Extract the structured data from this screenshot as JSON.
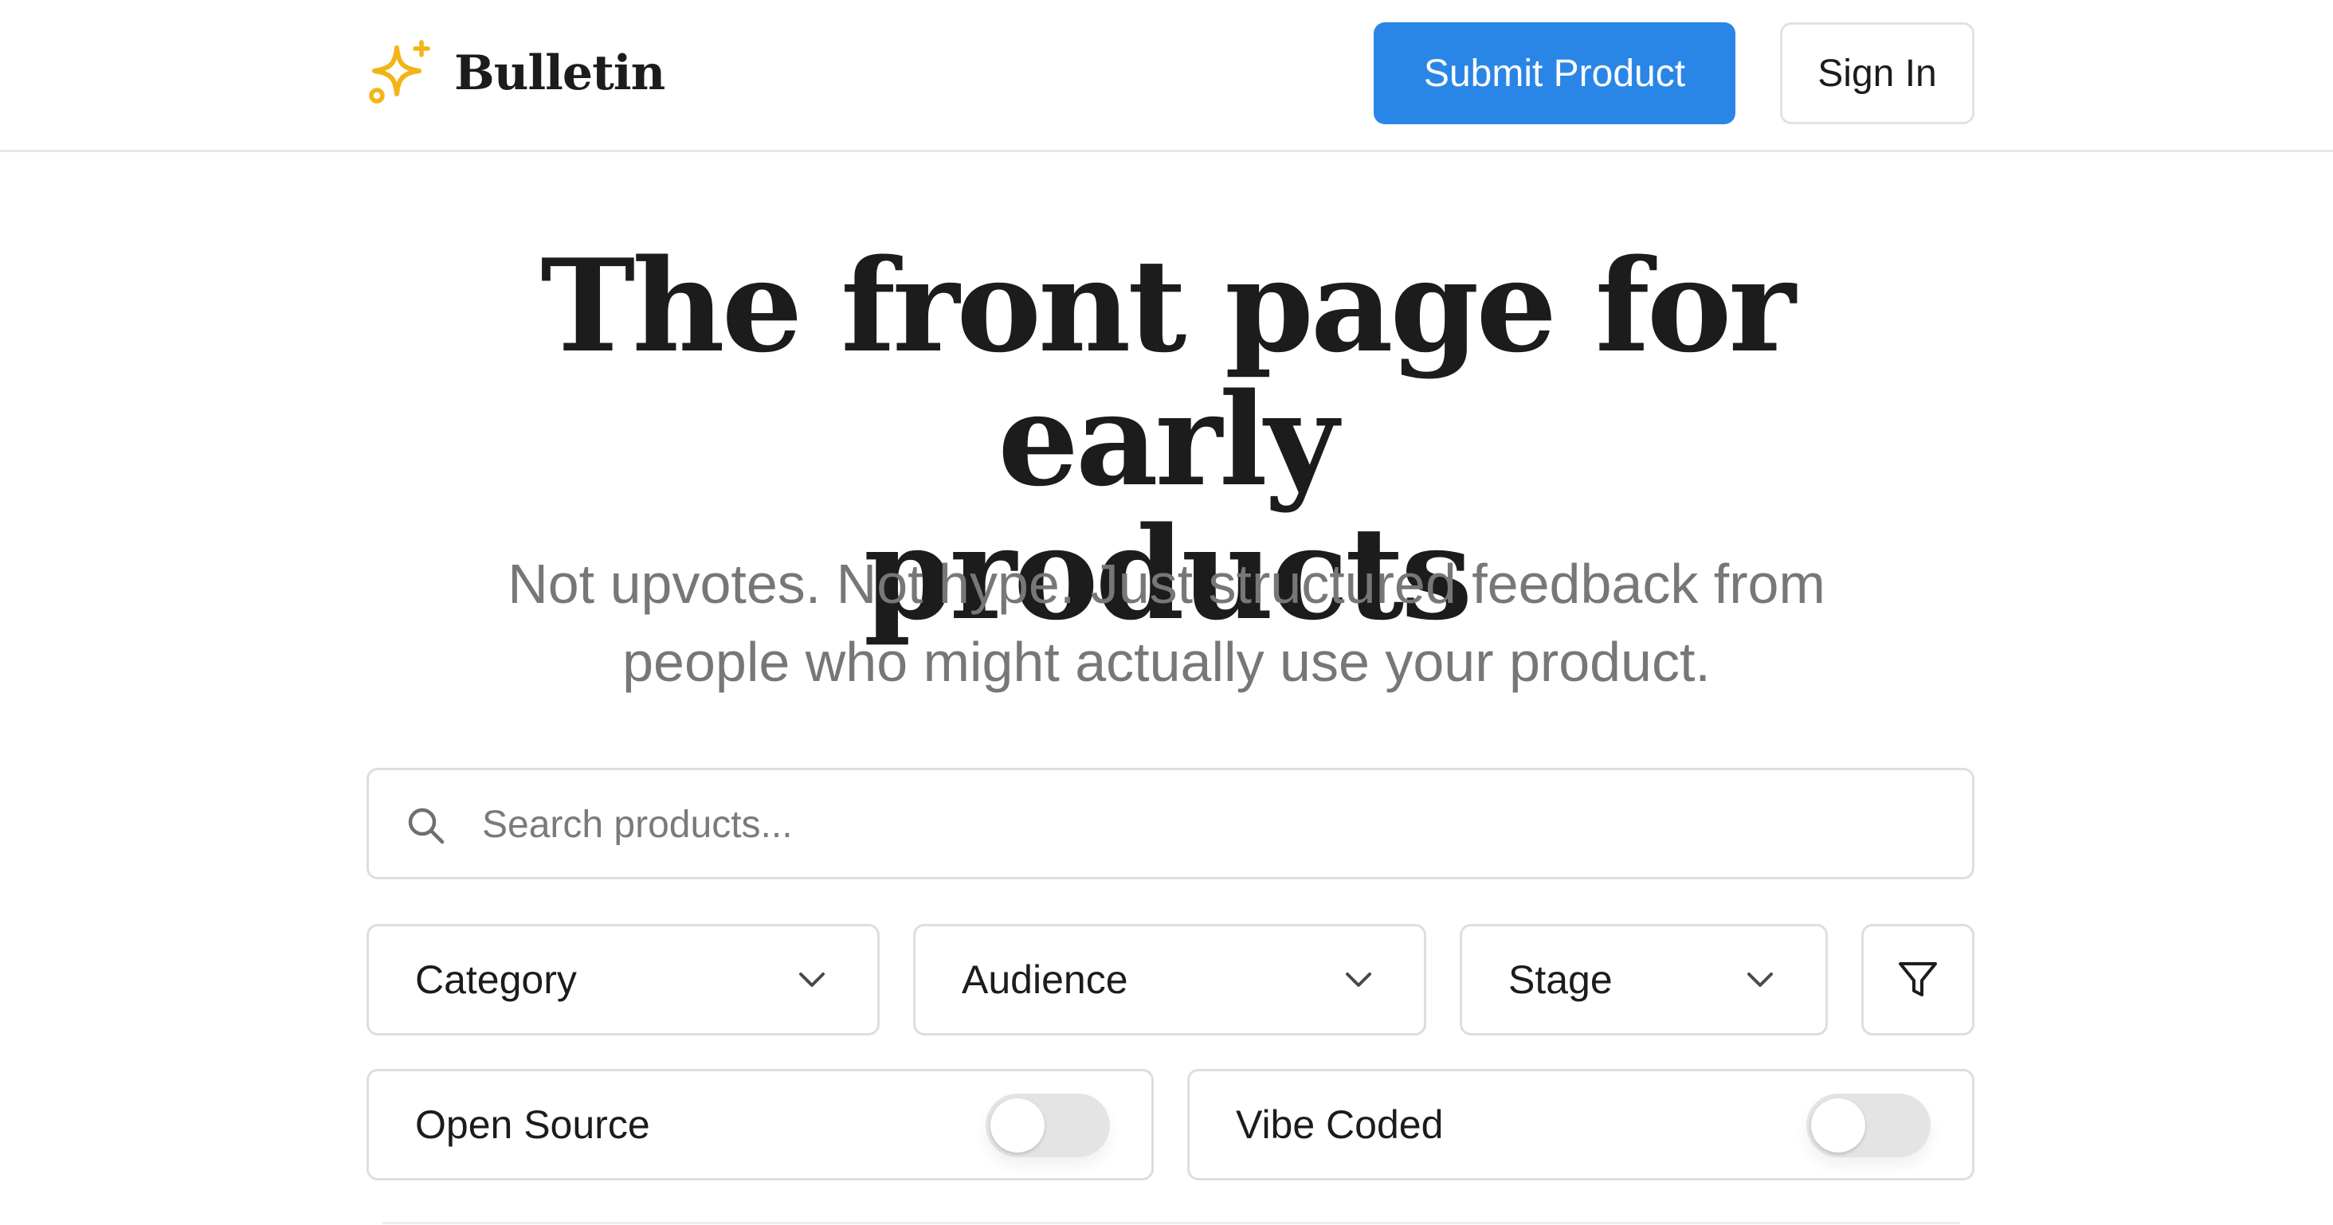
{
  "header": {
    "logo_icon": "sparkle-icon",
    "brand": "Bulletin",
    "submit_label": "Submit Product",
    "signin_label": "Sign In"
  },
  "hero": {
    "title_line1": "The front page for early",
    "title_line2": "products",
    "subtitle_line1": "Not upvotes. Not hype. Just structured feedback from",
    "subtitle_line2": "people who might actually use your product."
  },
  "search": {
    "icon": "search-icon",
    "placeholder": "Search products...",
    "value": ""
  },
  "filters": {
    "selects": [
      {
        "label": "Category"
      },
      {
        "label": "Audience"
      },
      {
        "label": "Stage"
      }
    ],
    "filter_icon": "filter-icon",
    "toggles": [
      {
        "label": "Open Source",
        "on": false
      },
      {
        "label": "Vibe Coded",
        "on": false
      }
    ]
  },
  "colors": {
    "primary": "#2a86e6",
    "logo_accent": "#f2b417",
    "text": "#1c1c1c",
    "muted_text": "#777777",
    "border": "#dedede",
    "toggle_off": "#e4e4e4"
  }
}
